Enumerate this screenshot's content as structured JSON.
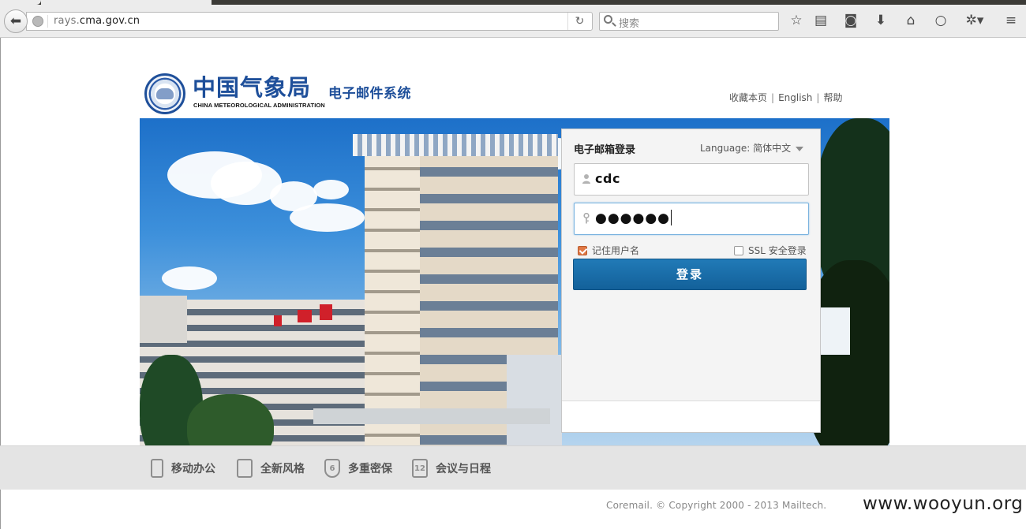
{
  "browser": {
    "url_prefix": "rays.",
    "url_host": "cma.gov.cn",
    "search_placeholder": "搜索"
  },
  "header": {
    "org_name": "中国气象局",
    "org_name_en": "CHINA METEOROLOGICAL ADMINISTRATION",
    "system_name": "电子邮件系统",
    "links": [
      "收藏本页",
      "English",
      "帮助"
    ]
  },
  "login": {
    "title": "电子邮箱登录",
    "language_label": "Language:",
    "language_value": "简体中文",
    "username_value": "cdc",
    "password_mask": "●●●●●●",
    "remember_label": "记住用户名",
    "remember_checked": true,
    "ssl_label": "SSL 安全登录",
    "ssl_checked": false,
    "submit_label": "登录"
  },
  "features": [
    {
      "label": "移动办公",
      "icon": "mobile-icon"
    },
    {
      "label": "全新风格",
      "icon": "style-icon"
    },
    {
      "label": "多重密保",
      "icon": "shield-icon",
      "badge": "6"
    },
    {
      "label": "会议与日程",
      "icon": "calendar-icon",
      "badge": "12"
    }
  ],
  "footer": {
    "copyright": "Coremail. © Copyright 2000 - 2013 Mailtech."
  },
  "watermark": "www.wooyun.org",
  "colors": {
    "brand_blue": "#1e4f9a",
    "button_blue": "#1a6fab",
    "checkbox_orange": "#e07845"
  }
}
